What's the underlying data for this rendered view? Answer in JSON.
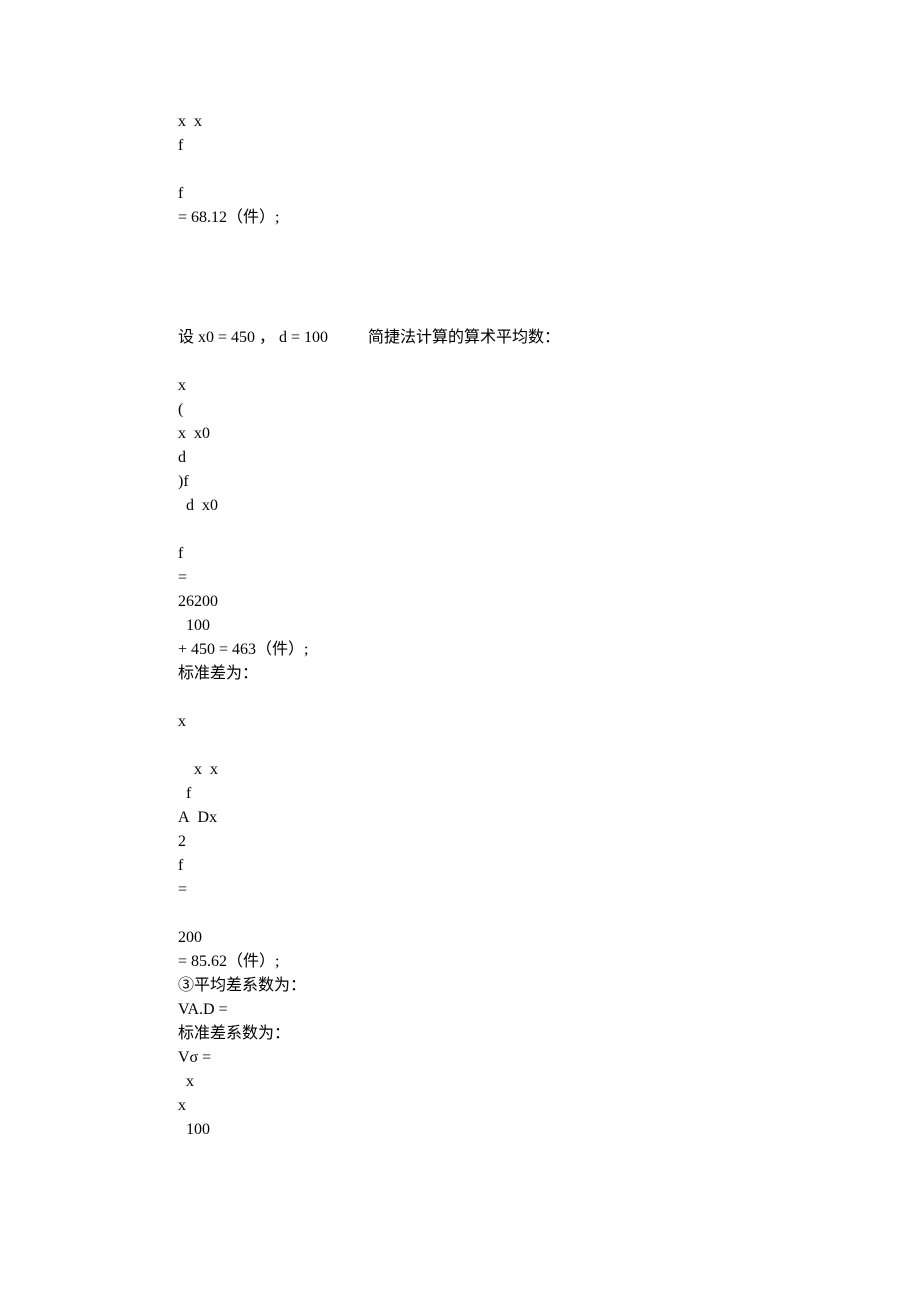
{
  "lines": [
    "x x",
    "f",
    " ",
    "f",
    "= 68.12（件）;",
    "",
    "",
    "",
    "",
    "设 x0 = 450 ， d = 100          简捷法计算的算术平均数：",
    " ",
    "x ",
    "(",
    "x x0",
    "d",
    ")f",
    " d x0",
    " ",
    "f",
    "=",
    "26200",
    " 100",
    "+ 450 = 463（件）;",
    "标准差为：",
    " ",
    "x",
    " ",
    "  x x ",
    " f",
    "A Dx",
    "2",
    "f",
    "=",
    "",
    "200",
    "= 85.62（件）;",
    "③平均差系数为：",
    "VA.D =",
    "标准差系数为：",
    "Vσ =",
    " x",
    "x",
    " 100"
  ]
}
